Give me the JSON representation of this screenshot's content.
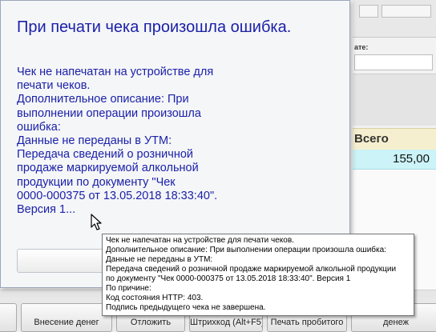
{
  "background": {
    "field_label": "ате:",
    "column_header": "Всего",
    "row_total": "155,00",
    "buttons": [
      "Внесение денег",
      "Отложить",
      "Штрихкод (Alt+F5)",
      "Печать пробитого",
      "",
      "денеж"
    ]
  },
  "dialog": {
    "title": "При печати чека произошла ошибка.",
    "message": "Чек не напечатан на устройстве для\nпечати чеков.\nДополнительное описание: При\nвыполнении операции произошла\nошибка:\nДанные не переданы в УТМ:\nПередача сведений о розничной\nпродаже маркируемой алкольной\nпродукции по документу \"Чек\n0000-000375 от 13.05.2018 18:33:40\".\nВерсия 1...",
    "ok_label": ""
  },
  "tooltip": {
    "lines": [
      "Чек не напечатан на устройстве для печати чеков.",
      "Дополнительное описание: При выполнении операции произошла ошибка:",
      "Данные не переданы в УТМ:",
      "Передача сведений о розничной продаже маркируемой алкольной продукции",
      "по документу \"Чек 0000-000375 от 13.05.2018 18:33:40\". Версия 1",
      "По причине:",
      "Код состояния HTTP: 403.",
      "Подпись предыдущего чека не завершена."
    ]
  },
  "colors": {
    "dialog_text": "#1b21a8",
    "row_highlight": "#ccf3f7",
    "header_bg": "#f6efcf"
  }
}
